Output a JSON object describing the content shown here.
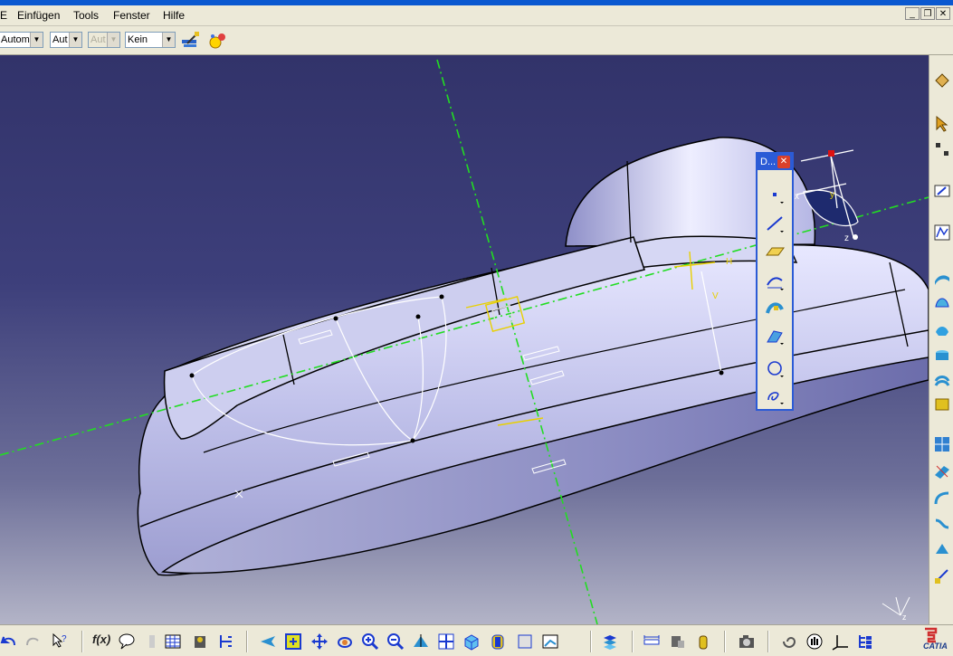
{
  "menubar": {
    "items": [
      "E",
      "Einfügen",
      "Tools",
      "Fenster",
      "Hilfe"
    ]
  },
  "toolbar": {
    "combo1": "Automa",
    "combo2": "Aut",
    "combo3": "Aut",
    "combo4": "Kein"
  },
  "floating_panel": {
    "title": "D...",
    "close_symbol": "✕"
  },
  "compass": {
    "axis_x": "x",
    "axis_y": "y",
    "axis_z": "z"
  },
  "sketch": {
    "v_label": "V",
    "h_label": "H"
  },
  "corner_axes": {
    "x": "x",
    "y": "y",
    "z": "z"
  },
  "bottombar": {
    "formula_label": "f(x)"
  },
  "logo": {
    "text": "CATIA"
  },
  "colors": {
    "viewport_top": "#32336a",
    "viewport_bottom": "#b3b4c7",
    "part_fill": "#c7c8ec",
    "axis_green": "#22dd22",
    "window_blue": "#2b5bd6"
  }
}
